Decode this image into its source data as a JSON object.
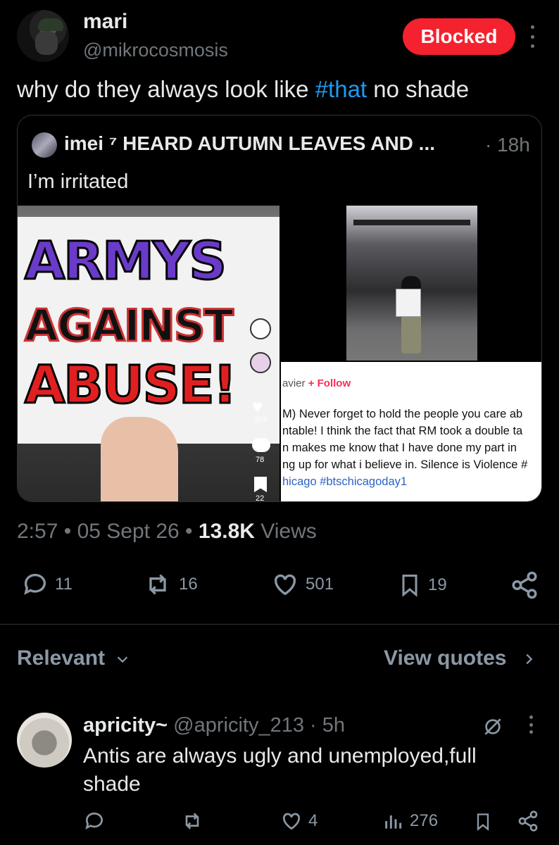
{
  "post": {
    "author_name": "mari",
    "author_handle": "@mikrocosmosis",
    "blocked_label": "Blocked",
    "text_before": "why do they always look like ",
    "hashtag": "#that",
    "text_after": " no shade",
    "time": "2:57",
    "date": "05 Sept 26",
    "views_count": "13.8K",
    "views_label": "Views",
    "sep": " • "
  },
  "quote": {
    "author_name": "imei ⁷ HEARD AUTUMN LEAVES AND ...",
    "time": "· 18h",
    "text": "I’m irritated",
    "poster": {
      "line1": "ARMYS",
      "line2": "AGAINST",
      "line3": "ABUSE!"
    },
    "tiktok": {
      "counts": [
        "303",
        "78",
        "22"
      ],
      "user": "avier",
      "follow": "+ Follow",
      "lines": [
        "M) Never forget to hold the people you care ab",
        "ntable! I think the fact that RM took a double ta",
        "n makes me know that I have done my part in",
        "ng up for what i believe in. Silence is Violence #"
      ],
      "tags": "hicago #btschicagoday1"
    }
  },
  "actions": {
    "replies": "11",
    "reposts": "16",
    "likes": "501",
    "bookmarks": "19"
  },
  "filters": {
    "sort": "Relevant",
    "view_quotes": "View quotes"
  },
  "reply": {
    "author_name": "apricity~",
    "author_handle": "@apricity_213",
    "time": "· 5h",
    "text": "Antis are always ugly and unemployed,full shade",
    "likes": "4",
    "views": "276"
  },
  "colors": {
    "blocked": "#f4212e",
    "link": "#1d9bf0",
    "muted": "#71767b"
  },
  "icons": [
    "more-icon",
    "reply-icon",
    "repost-icon",
    "like-icon",
    "bookmark-icon",
    "share-icon",
    "chevron-down-icon",
    "chevron-right-icon",
    "grok-icon",
    "views-icon"
  ]
}
